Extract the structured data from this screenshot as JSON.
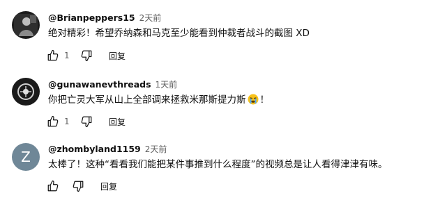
{
  "comments": [
    {
      "author": "@Brianpeppers15",
      "time": "2天前",
      "text": "绝对精彩！希望乔纳森和马克至少能看到仲裁者战斗的截图 XD",
      "likes": "1",
      "reply_label": "回复",
      "avatar_icon": "dark-figure-avatar"
    },
    {
      "author": "@gunawanevthreads",
      "time": "1天前",
      "text_before": "你把亡灵大军从山上全部调来拯救米那斯提力斯",
      "emoji": "crying-face-emoji",
      "text_after": "！",
      "likes": "1",
      "reply_label": "回复",
      "avatar_icon": "dark-logo-avatar"
    },
    {
      "author": "@zhombyland1159",
      "time": "2天前",
      "avatar_letter": "Z",
      "avatar_color": "#6f8797",
      "text": "太棒了！这种“看看我们能把某件事推到什么程度”的视频总是让人看得津津有味。",
      "likes": "",
      "reply_label": "回复"
    }
  ]
}
